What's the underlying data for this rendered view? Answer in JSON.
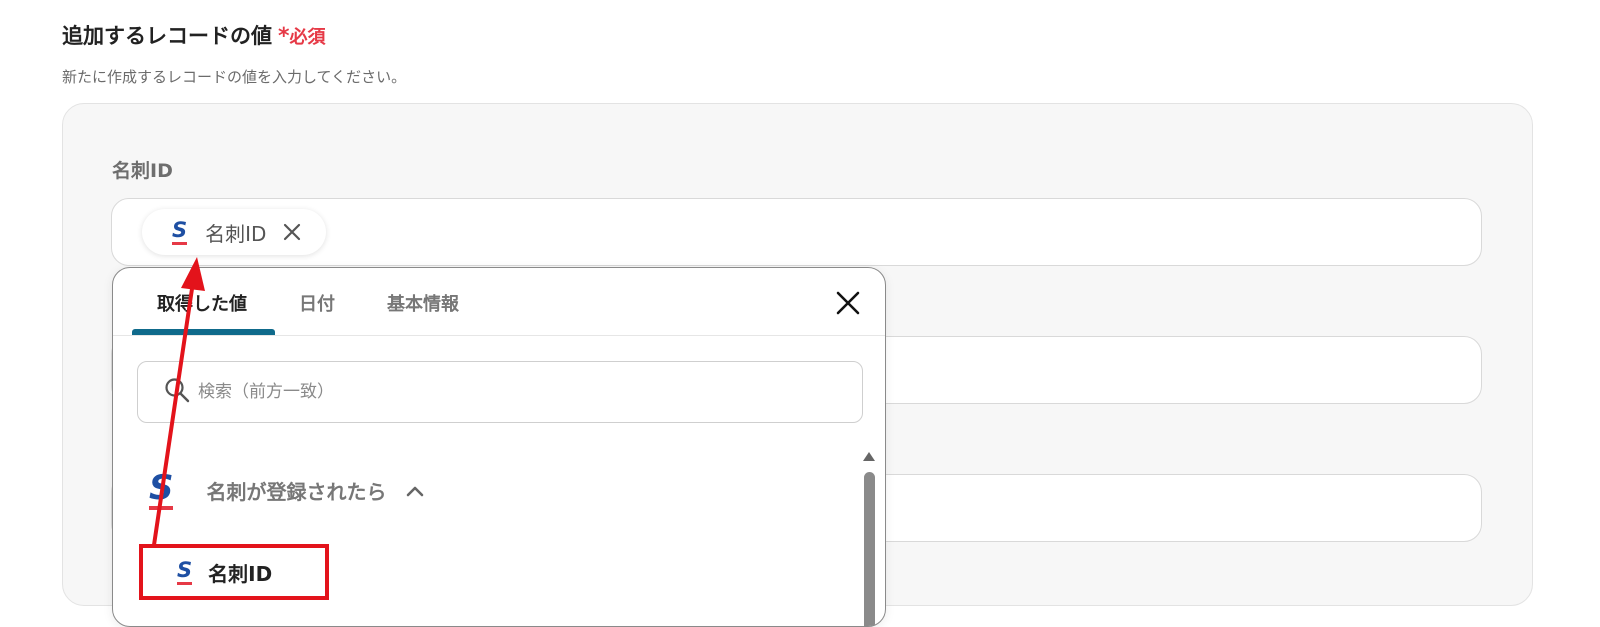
{
  "section": {
    "title": "追加するレコードの値",
    "required_star": "*",
    "required_label": "必須",
    "description": "新たに作成するレコードの値を入力してください。"
  },
  "field": {
    "label": "名刺ID",
    "chip_label": "名刺ID"
  },
  "popover": {
    "tabs": [
      {
        "label": "取得した値",
        "active": true
      },
      {
        "label": "日付",
        "active": false
      },
      {
        "label": "基本情報",
        "active": false
      }
    ],
    "search_placeholder": "検索（前方一致）",
    "group_label": "名刺が登録されたら",
    "item_label": "名刺ID"
  },
  "logo_letter": "S",
  "colors": {
    "accent_blue": "#1e4fa3",
    "logo_red": "#e63946",
    "required_red": "#e63946",
    "tab_underline": "#0f6a8b",
    "highlight_red": "#e3131b"
  },
  "icons": [
    "sansan-logo-icon",
    "close-icon",
    "search-icon",
    "chevron-up-icon",
    "scroll-up-icon"
  ]
}
